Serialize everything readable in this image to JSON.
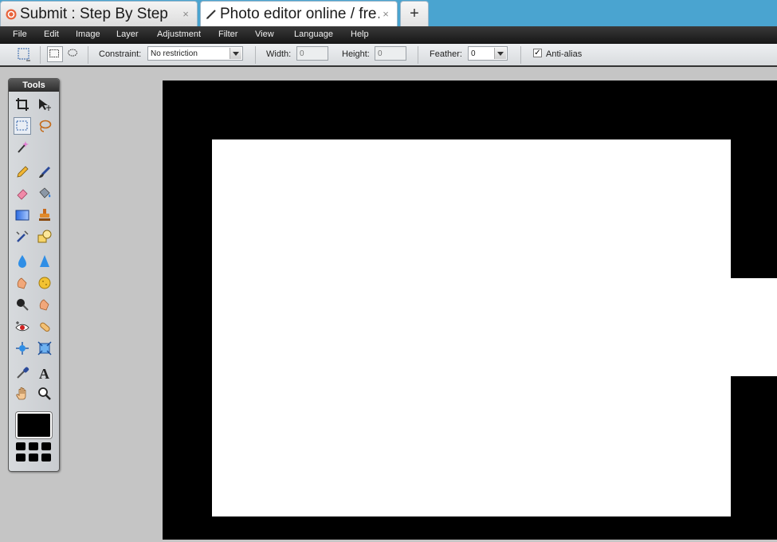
{
  "browser": {
    "tabs": [
      {
        "title": "Submit : Step By Step",
        "favicon": "stumble-icon",
        "close": "×"
      },
      {
        "title": "Photo editor online / fre…",
        "favicon": "pencil-icon",
        "close": "×"
      }
    ],
    "new_tab_label": "+"
  },
  "menu": {
    "items": [
      "File",
      "Edit",
      "Image",
      "Layer",
      "Adjustment",
      "Filter",
      "View",
      "Language",
      "Help"
    ]
  },
  "options": {
    "constraint_label": "Constraint:",
    "constraint_value": "No restriction",
    "width_label": "Width:",
    "width_value": "0",
    "height_label": "Height:",
    "height_value": "0",
    "feather_label": "Feather:",
    "feather_value": "0",
    "antialias_label": "Anti-alias",
    "antialias_checked": true,
    "antialias_check_glyph": "✓"
  },
  "tools": {
    "title": "Tools",
    "icons": [
      "crop-icon",
      "move-icon",
      "marquee-icon",
      "lasso-icon",
      "wand-icon",
      "pencil-icon",
      "brush-icon",
      "eraser-icon",
      "bucket-icon",
      "gradient-icon",
      "stamp-icon",
      "replace-color-icon",
      "shapes-icon",
      "blur-icon",
      "sharpen-icon",
      "smudge-icon",
      "sponge-icon",
      "dodge-icon",
      "burn-icon",
      "redeye-icon",
      "spot-heal-icon",
      "bloat-icon",
      "pinch-icon",
      "picker-icon",
      "type-icon",
      "hand-icon",
      "zoom-icon"
    ],
    "foreground_color": "#000000"
  },
  "colors": {
    "tab_strip": "#4aa4d0",
    "menubar": "#1f1f1f",
    "canvas_black": "#000000",
    "canvas_white": "#ffffff",
    "workspace": "#c5c5c5"
  }
}
